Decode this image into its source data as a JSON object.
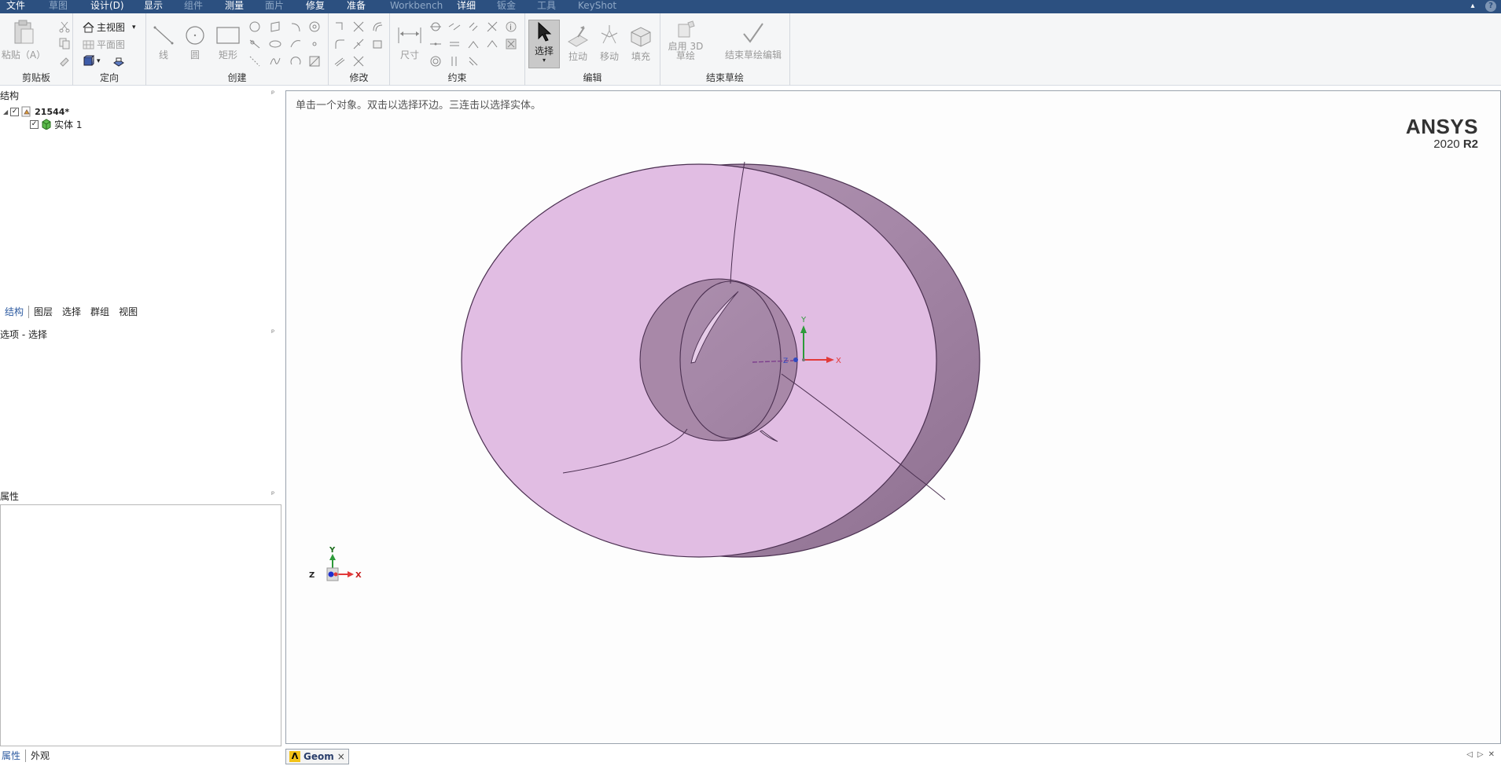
{
  "menu": {
    "items": [
      {
        "label": "文件",
        "dim": false
      },
      {
        "label": "草图",
        "dim": true
      },
      {
        "label": "设计(D)",
        "dim": false
      },
      {
        "label": "显示",
        "dim": false
      },
      {
        "label": "组件",
        "dim": true
      },
      {
        "label": "测量",
        "dim": false
      },
      {
        "label": "面片",
        "dim": true
      },
      {
        "label": "修复",
        "dim": false
      },
      {
        "label": "准备",
        "dim": false
      },
      {
        "label": "Workbench",
        "dim": true
      },
      {
        "label": "详细",
        "dim": false
      },
      {
        "label": "钣金",
        "dim": true
      },
      {
        "label": "工具",
        "dim": true
      },
      {
        "label": "KeyShot",
        "dim": true
      }
    ],
    "help_label": "?",
    "collapse_label": "▴"
  },
  "ribbon": {
    "clipboard": {
      "group_label": "剪贴板",
      "paste_label": "粘贴（A）"
    },
    "orient": {
      "group_label": "定向",
      "home_view": "主视图",
      "plan_view": "平面图"
    },
    "create": {
      "group_label": "创建",
      "line": "线",
      "circle": "圆",
      "rect": "矩形"
    },
    "modify": {
      "group_label": "修改"
    },
    "constraints": {
      "group_label": "约束",
      "dimension": "尺寸"
    },
    "edit": {
      "group_label": "编辑",
      "select": "选择",
      "pull": "拉动",
      "move": "移动",
      "fill": "填充"
    },
    "end_sketch": {
      "group_label": "结束草绘",
      "enable3d": "启用 3D 草绘",
      "end_edit": "结束草绘编辑"
    }
  },
  "structure_panel": {
    "title": "结构",
    "root_label": "21544*",
    "body_label": "实体 1",
    "tabs": [
      "结构",
      "图层",
      "选择",
      "群组",
      "视图"
    ]
  },
  "options_panel": {
    "title": "选项 - 选择"
  },
  "properties_panel": {
    "title": "属性",
    "tabs": [
      "属性",
      "外观"
    ]
  },
  "viewport": {
    "hint": "单击一个对象。双击以选择环边。三连击以选择实体。",
    "brand_name": "ANSYS",
    "brand_year": "2020",
    "brand_release": "R2",
    "axes": {
      "x": "X",
      "y": "Y",
      "z": "Z"
    },
    "colors": {
      "face": "#e1bde3",
      "side": "#a888a8",
      "edge": "#4a2f50"
    }
  },
  "doc_tab": {
    "label": "Geom",
    "close": "×",
    "logo": "Λ"
  },
  "nav": {
    "prev": "◁",
    "next": "▷",
    "close": "✕"
  }
}
